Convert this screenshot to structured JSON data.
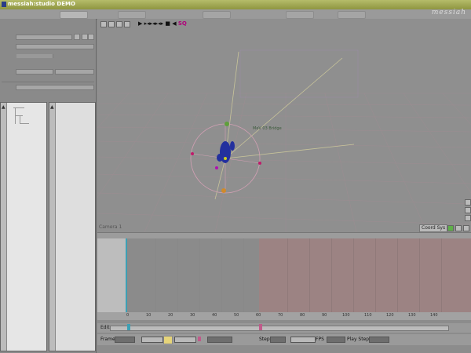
{
  "window": {
    "title": "messiah:studio DEMO",
    "logo": "messiah"
  },
  "viewport": {
    "label": "Camera 1",
    "coord_button": "Coord Sys",
    "playback_label": "▶ ▸◂▸◂▸◂▸ ■ ◀",
    "object_label": "MeV 03 Bridge",
    "mode_glyph": "SQ"
  },
  "timeline": {
    "ruler_ticks": [
      "0",
      "10",
      "20",
      "30",
      "40",
      "50",
      "60",
      "70",
      "80",
      "90",
      "100",
      "110",
      "120",
      "130",
      "140"
    ]
  },
  "edit_row": {
    "label": "Edit"
  },
  "bottombar": {
    "frame_label": "Frame",
    "step_label": "Step",
    "fps_label": "FPS",
    "play_step_label": "Play Step"
  },
  "colors": {
    "titlebar": "#9aa14a",
    "timeline_pink": "#9c8383",
    "gizmo_ring": "#d2a0b4"
  }
}
